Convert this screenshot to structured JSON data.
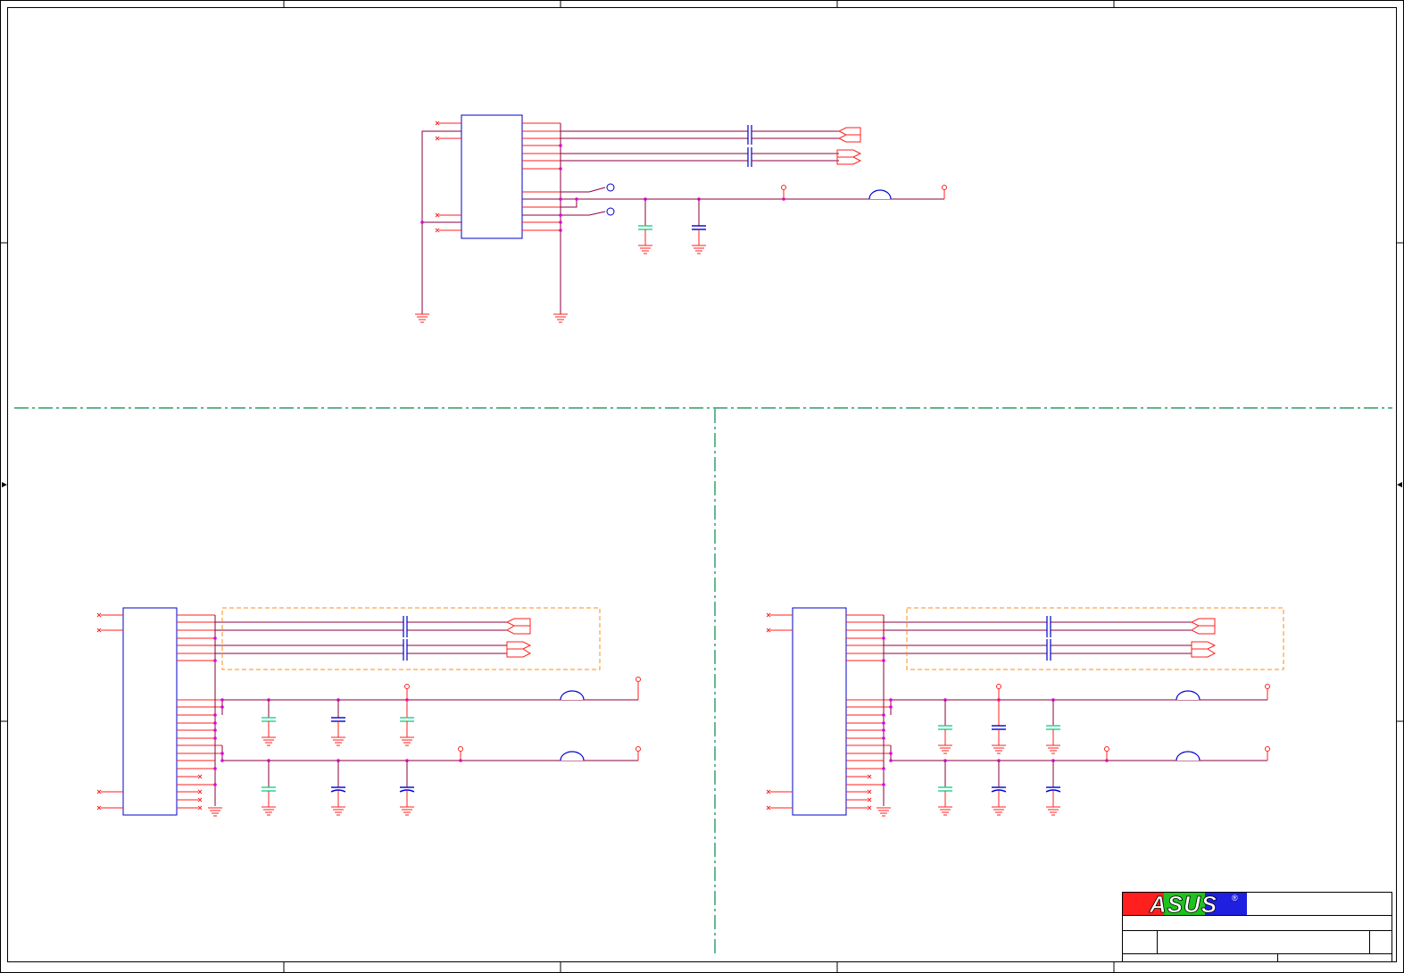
{
  "title_block": {
    "brand": "ASUS",
    "registered_mark": "®",
    "brand_colors": [
      "#ff1f1f",
      "#1ec21e",
      "#1f1fe0"
    ]
  },
  "colors": {
    "wire": "#ff1f1f",
    "net": "#8b003d",
    "component": "#0000cc",
    "junction": "#e000e0",
    "divider": "#008a4a",
    "group_box": "#ff8c1a",
    "cap_alt": "#20d08a",
    "border": "#000000"
  }
}
